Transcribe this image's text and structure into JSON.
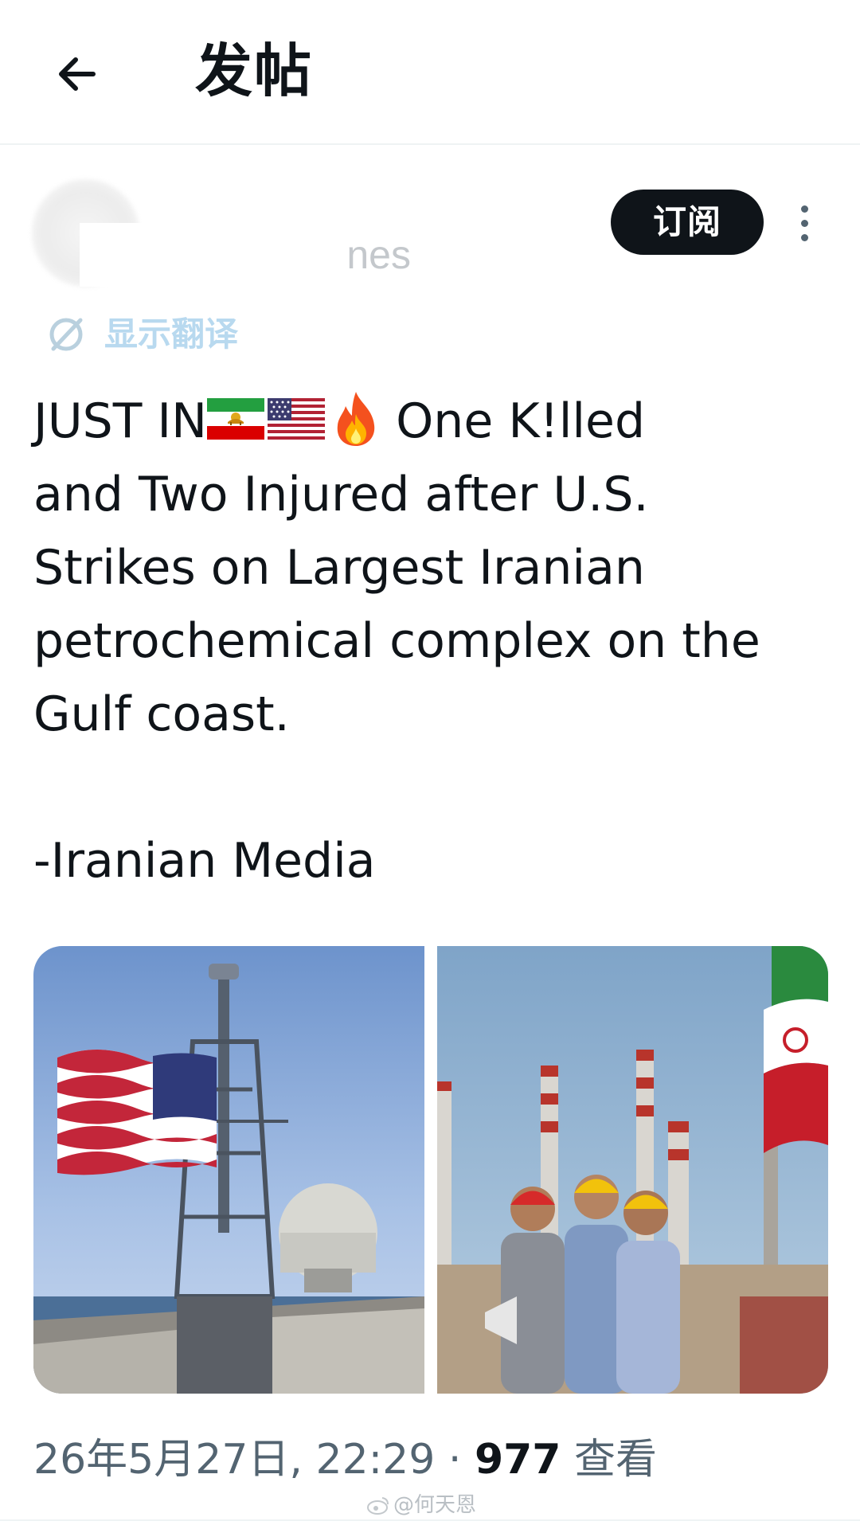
{
  "header": {
    "title": "发帖"
  },
  "author": {
    "name_visible_fragment": "nes",
    "subscribe_label": "订阅"
  },
  "translate": {
    "label": "显示翻译"
  },
  "post": {
    "lines": [
      {
        "text_before": "JUST IN",
        "flags": [
          "iran-lion-sun-flag-icon",
          "usa-flag-icon"
        ],
        "emoji": "fire-emoji-icon",
        "text_after": "One K!lled"
      },
      {
        "text": "and Two Injured after U.S."
      },
      {
        "text": "Strikes on Largest Iranian"
      },
      {
        "text": "petrochemical complex on the"
      },
      {
        "text": "Gulf coast."
      },
      {
        "text": ""
      },
      {
        "text": "-Iranian Media"
      }
    ]
  },
  "media": [
    {
      "subject": "us-flag-warship-image"
    },
    {
      "subject": "iran-petrochemical-workers-image"
    }
  ],
  "meta": {
    "timestamp": "26年5月27日, 22:29",
    "separator": "·",
    "views_count": "977",
    "views_label": "查看"
  },
  "watermark": {
    "text": "@何天恩"
  },
  "colors": {
    "text_primary": "#0f1419",
    "text_secondary": "#536471",
    "subscribe_bg": "#0f1419",
    "translate_link": "#b8d9ef",
    "divider": "#eff3f4"
  }
}
